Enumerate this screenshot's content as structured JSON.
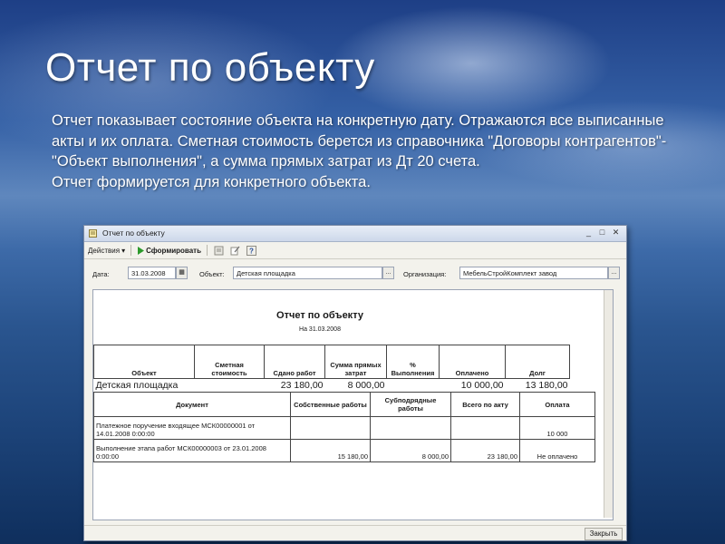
{
  "slide": {
    "title": "Отчет по объекту",
    "paragraph1": "Отчет показывает состояние объекта на конкретную дату. Отражаются все выписанные акты и их оплата. Сметная стоимость берется из справочника \"Договоры контрагентов\"-\"Объект выполнения\", а сумма прямых затрат из Дт 20 счета.",
    "paragraph2": "Отчет формируется для конкретного объекта."
  },
  "window": {
    "title": "Отчет по объекту",
    "toolbar": {
      "actions_label": "Действия",
      "generate_label": "Сформировать"
    },
    "filters": {
      "date_label": "Дата:",
      "date_value": "31.03.2008",
      "object_label": "Объект:",
      "object_value": "Детская площадка",
      "org_label": "Организация:",
      "org_value": "МебельСтройКомплект завод"
    },
    "close_label": "Закрыть"
  },
  "report": {
    "title": "Отчет по объекту",
    "date": "На 31.03.2008",
    "summary_headers": [
      "Объект",
      "Сметная стоимость",
      "Сдано работ",
      "Сумма прямых затрат",
      "% Выполнения",
      "Оплачено",
      "Долг"
    ],
    "summary_row": {
      "object": "Детская площадка",
      "estimated_cost": "",
      "delivered": "23 180,00",
      "direct_costs": "8 000,00",
      "completion_pct": "",
      "paid": "10 000,00",
      "debt": "13 180,00"
    },
    "detail_headers": [
      "Документ",
      "Собственные работы",
      "Субподрядные работы",
      "Всего по акту",
      "Оплата"
    ],
    "detail_rows": [
      {
        "document": "Платежное поручение входящее МСК00000001 от 14.01.2008 0:00:00",
        "own_works": "",
        "subcontract_works": "",
        "total_act": "",
        "payment": "10 000"
      },
      {
        "document": "Выполнение этапа работ МСК00000003 от 23.01.2008 0:00:00",
        "own_works": "15 180,00",
        "subcontract_works": "8 000,00",
        "total_act": "23 180,00",
        "payment": "Не оплачено"
      }
    ]
  }
}
